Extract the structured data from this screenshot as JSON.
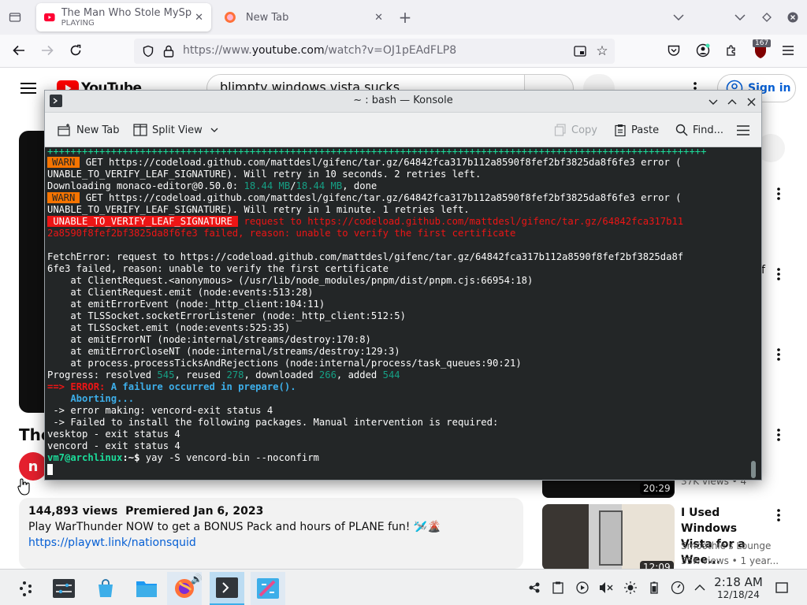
{
  "browser": {
    "tabs": [
      {
        "title": "The Man Who Stole MySp",
        "subtitle": "PLAYING"
      },
      {
        "title": "New Tab"
      }
    ],
    "url_prefix": "https://www.",
    "url_domain": "youtube.com",
    "url_path": "/watch?v=OJ1pEAdFLP8",
    "extension_badge": "167"
  },
  "youtube": {
    "logo_text": "YouTube",
    "search_value": "blimpty windows vista sucks",
    "sign_in": "Sign in",
    "title_fragment": "The",
    "side_fragment": "f",
    "video_meta": "144,893 views  Premiered Jan 6, 2023",
    "description": "Play WarThunder NOW to get a BONUS Pack and hours of PLANE fun! 🛩️🌋",
    "link": "https://playwt.link/nationsquid",
    "rec_duration_1": "20:29",
    "rec_views_1": "37K views • 4",
    "rec_title_2": "I Used Windows Vista for a Wee...",
    "rec_channel_2": "Smoothie's Lounge",
    "rec_views_2": "35K views • 1 year...",
    "rec_duration_2": "12:09"
  },
  "konsole": {
    "title": "~ : bash — Konsole",
    "toolbar": {
      "new_tab": "New Tab",
      "split_view": "Split View",
      "copy": "Copy",
      "paste": "Paste",
      "find": "Find..."
    },
    "lines": {
      "progress": "++++++++++++++++++++++++++++++++++++++++++++++++++++++++++++++++++++++++++++++++++++++++++++++++++++++++++++++++++",
      "warn_label": "WARN",
      "warn1_a": " GET https://codeload.github.com/mattdesl/gifenc/tar.gz/64842fca317b112a8590f8fef2bf3825da8f6fe3 error (",
      "warn1_b": "UNABLE_TO_VERIFY_LEAF_SIGNATURE). Will retry in 10 seconds. 2 retries left.",
      "dl_a": "Downloading monaco-editor@0.50.0: ",
      "dl_size1": "18.44 MB",
      "dl_slash": "/",
      "dl_size2": "18.44 MB",
      "dl_done": ", done",
      "warn2_a": " GET https://codeload.github.com/mattdesl/gifenc/tar.gz/64842fca317b112a8590f8fef2bf3825da8f6fe3 error (",
      "warn2_b": "UNABLE_TO_VERIFY_LEAF_SIGNATURE). Will retry in 1 minute. 1 retries left.",
      "err_label": " UNABLE_TO_VERIFY_LEAF_SIGNATURE ",
      "err_a": " request to https://codeload.github.com/mattdesl/gifenc/tar.gz/64842fca317b11",
      "err_b": "2a8590f8fef2bf3825da8f6fe3 failed, reason: unable to verify the first certificate",
      "fetch_a": "FetchError: request to https://codeload.github.com/mattdesl/gifenc/tar.gz/64842fca317b112a8590f8fef2bf3825da8f",
      "fetch_b": "6fe3 failed, reason: unable to verify the first certificate",
      "stack": [
        "    at ClientRequest.<anonymous> (/usr/lib/node_modules/pnpm/dist/pnpm.cjs:66954:18)",
        "    at ClientRequest.emit (node:events:513:28)",
        "    at emitErrorEvent (node:_http_client:104:11)",
        "    at TLSSocket.socketErrorListener (node:_http_client:512:5)",
        "    at TLSSocket.emit (node:events:525:35)",
        "    at emitErrorNT (node:internal/streams/destroy:170:8)",
        "    at emitErrorCloseNT (node:internal/streams/destroy:129:3)",
        "    at process.processTicksAndRejections (node:internal/process/task_queues:90:21)"
      ],
      "prog_a": "Progress: resolved ",
      "prog_resolved": "545",
      "prog_b": ", reused ",
      "prog_reused": "278",
      "prog_c": ", downloaded ",
      "prog_downloaded": "266",
      "prog_d": ", added ",
      "prog_added": "544",
      "arrow": "==>",
      "error_word": " ERROR:",
      "error_msg": " A failure occurred in prepare().",
      "aborting": "    Aborting...",
      "make_err": " -> error making: vencord-exit status 4",
      "install_fail": " -> Failed to install the following packages. Manual intervention is required:",
      "pkg1": "vesktop - exit status 4",
      "pkg2": "vencord - exit status 4",
      "prompt_user": "vm7@archlinux",
      "prompt_sep": ":~$",
      "command": " yay -S vencord-bin --noconfirm"
    }
  },
  "taskbar": {
    "time": "2:18 AM",
    "date": "12/18/24"
  },
  "colors": {
    "konsole_bg": "#232627",
    "warn": "#f67400",
    "error": "#ed1515",
    "green": "#1cdc9a",
    "youtube_red": "#ff0000"
  }
}
